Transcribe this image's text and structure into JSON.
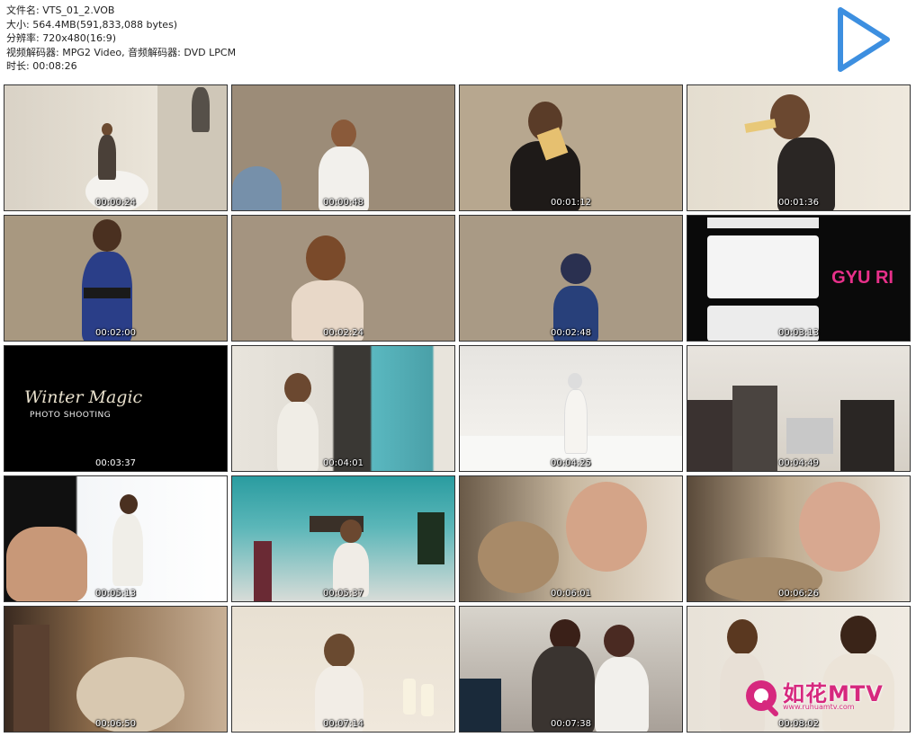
{
  "info": {
    "filename": "文件名: VTS_01_2.VOB",
    "size": "大小: 564.4MB(591,833,088 bytes)",
    "resolution": "分辨率: 720x480(16:9)",
    "codecs": "视频解码器: MPG2 Video, 音频解码器: DVD LPCM",
    "duration": "时长: 00:08:26"
  },
  "play_icon": "play-triangle-icon",
  "thumbnails": [
    {
      "time": "00:00:24"
    },
    {
      "time": "00:00:48"
    },
    {
      "time": "00:01:12"
    },
    {
      "time": "00:01:36"
    },
    {
      "time": "00:02:00"
    },
    {
      "time": "00:02:24"
    },
    {
      "time": "00:02:48"
    },
    {
      "time": "00:03:13",
      "overlay": "GYU RI"
    },
    {
      "time": "00:03:37",
      "title": "Winter Magic",
      "subtitle": "PHOTO SHOOTING"
    },
    {
      "time": "00:04:01"
    },
    {
      "time": "00:04:25"
    },
    {
      "time": "00:04:49"
    },
    {
      "time": "00:05:13"
    },
    {
      "time": "00:05:37"
    },
    {
      "time": "00:06:01"
    },
    {
      "time": "00:06:26"
    },
    {
      "time": "00:06:50"
    },
    {
      "time": "00:07:14"
    },
    {
      "time": "00:07:38"
    },
    {
      "time": "00:08:02"
    }
  ],
  "watermark": {
    "brand": "如花MTV",
    "url": "www.ruhuamtv.com",
    "color": "#d6287e"
  }
}
